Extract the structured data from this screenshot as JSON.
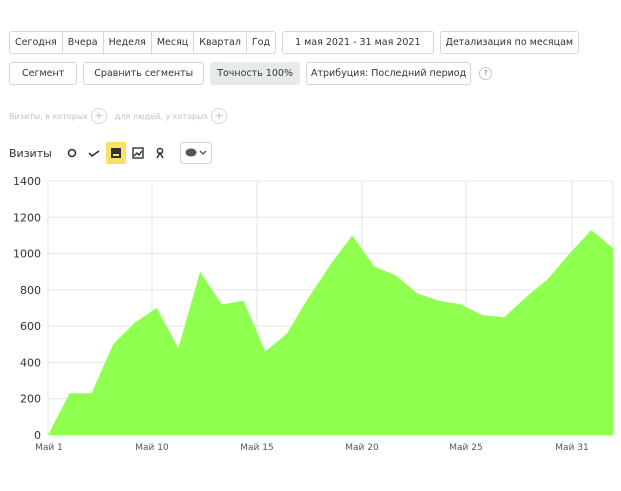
{
  "periods": [
    "Сегодня",
    "Вчера",
    "Неделя",
    "Месяц",
    "Квартал",
    "Год"
  ],
  "date_range": "1 мая 2021 - 31 мая 2021",
  "detail": "Детализация по месяцам",
  "segment_btn": "Сегмент",
  "compare_btn": "Сравнить сегменты",
  "accuracy_btn": "Точность 100%",
  "attribution_btn": "Атрибуция: Последний период",
  "help": "?",
  "filter_visits": "Визиты, в которых",
  "filter_people": "для людей, у которых",
  "metric": "Визиты",
  "colors": {
    "area": "#8fff50",
    "grid": "#e6e6e6",
    "active_tool": "#ffe066"
  },
  "chart_data": {
    "type": "area",
    "x": [
      1,
      2,
      3,
      4,
      5,
      6,
      7,
      8,
      9,
      10,
      11,
      12,
      13,
      14,
      15,
      16,
      17,
      18,
      19,
      20,
      21,
      22,
      23,
      24,
      25,
      26,
      27,
      28,
      29,
      30,
      31,
      32
    ],
    "values": [
      0,
      230,
      230,
      500,
      620,
      700,
      480,
      900,
      720,
      740,
      460,
      560,
      760,
      940,
      1100,
      930,
      880,
      780,
      740,
      720,
      660,
      650,
      760,
      860,
      1000,
      1130,
      1030
    ],
    "series": [
      {
        "values": [
          0,
          230,
          230,
          500,
          620,
          700,
          480,
          900,
          720,
          740,
          460,
          560,
          760,
          940,
          1100,
          930,
          880,
          780,
          740,
          720,
          660,
          650,
          760,
          860,
          1000,
          1130,
          1030
        ]
      }
    ],
    "x_values": [
      1,
      2,
      3,
      4,
      5,
      6,
      7,
      8,
      9,
      10,
      11,
      12,
      13,
      14,
      15,
      16,
      17,
      18,
      19,
      20,
      21,
      22,
      23,
      24,
      25,
      26,
      27,
      28,
      29,
      30,
      31,
      32
    ],
    "yticks": [
      "0",
      "200",
      "400",
      "600",
      "800",
      "1000",
      "1200",
      "1400"
    ],
    "xticks": [
      "Май 1",
      "Май 10",
      "Май 15",
      "Май 20",
      "Май 25",
      "Май 31"
    ],
    "ylim": [
      0,
      1400
    ],
    "grid": true
  }
}
